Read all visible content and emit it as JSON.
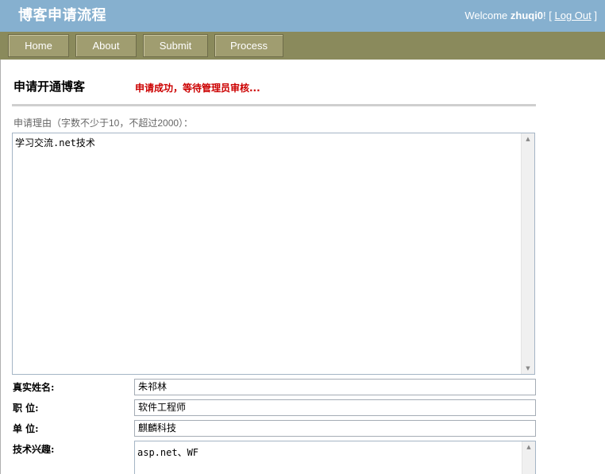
{
  "header": {
    "site_title": "博客申请流程",
    "welcome_text": "Welcome ",
    "username": "zhuqi0",
    "bang": "! [ ",
    "logout_label": "Log Out",
    "close_bracket": " ]"
  },
  "nav": {
    "items": [
      {
        "label": "Home"
      },
      {
        "label": "About"
      },
      {
        "label": "Submit"
      },
      {
        "label": "Process"
      }
    ]
  },
  "main": {
    "page_title": "申请开通博客",
    "success_message": "申请成功，等待管理员审核...",
    "reason_label": "申请理由（字数不少于10，不超过2000）：",
    "reason_value": "学习交流.net技术",
    "fields": {
      "real_name": {
        "label": "真实姓名:",
        "value": "朱祁林"
      },
      "position": {
        "label": "职  位:",
        "value": "软件工程师"
      },
      "company": {
        "label": "单  位:",
        "value": "麒麟科技"
      },
      "interests": {
        "label": "技术兴趣:",
        "value": "asp.net、WF"
      }
    }
  },
  "colors": {
    "header_bg": "#86b0cf",
    "navbar_bg": "#8a8a5c",
    "nav_button_bg": "#a09d70",
    "success_text": "#cc0000"
  }
}
